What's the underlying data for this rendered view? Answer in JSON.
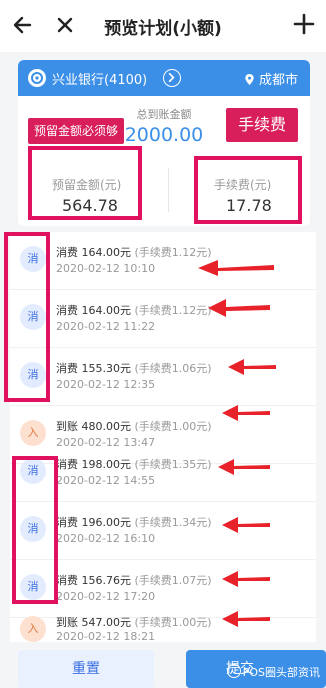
{
  "header": {
    "title": "预览计划(小额)"
  },
  "bank": {
    "name": "兴业银行(4100)",
    "city": "成都市"
  },
  "summary": {
    "total_label": "总到账金额",
    "total_value": "2000.00",
    "tag_left": "预留金额必须够",
    "tag_right": "手续费",
    "reserve_label": "预留金额(元)",
    "reserve_value": "564.78",
    "fee_label": "手续费(元)",
    "fee_value": "17.78"
  },
  "transactions": [
    {
      "badge": "消",
      "type": "spend",
      "title": "消费 164.00元",
      "fee": "(手续费1.12元)",
      "time": "2020-02-12 10:10"
    },
    {
      "badge": "消",
      "type": "spend",
      "title": "消费 164.00元",
      "fee": "(手续费1.12元)",
      "time": "2020-02-12 11:22"
    },
    {
      "badge": "消",
      "type": "spend",
      "title": "消费 155.30元",
      "fee": "(手续费1.06元)",
      "time": "2020-02-12 12:35"
    },
    {
      "badge": "入",
      "type": "arrive",
      "title": "到账 480.00元",
      "fee": "(手续费1.00元)",
      "time": "2020-02-12 13:47"
    },
    {
      "badge": "消",
      "type": "spend",
      "title": "消费 198.00元",
      "fee": "(手续费1.35元)",
      "time": "2020-02-12 14:55"
    },
    {
      "badge": "消",
      "type": "spend",
      "title": "消费 196.00元",
      "fee": "(手续费1.34元)",
      "time": "2020-02-12 16:10"
    },
    {
      "badge": "消",
      "type": "spend",
      "title": "消费 156.76元",
      "fee": "(手续费1.07元)",
      "time": "2020-02-12 17:20"
    },
    {
      "badge": "入",
      "type": "arrive",
      "title": "到账 547.00元",
      "fee": "(手续费1.00元)",
      "time": "2020-02-12 18:21"
    }
  ],
  "buttons": {
    "reset": "重置",
    "submit": "提交"
  },
  "watermark": "POS圈头部资讯",
  "colors": {
    "accent": "#3c8fe7",
    "annotation": "#e0115f",
    "spend_badge": "#e3ebff",
    "arrive_badge": "#fde0cf"
  }
}
